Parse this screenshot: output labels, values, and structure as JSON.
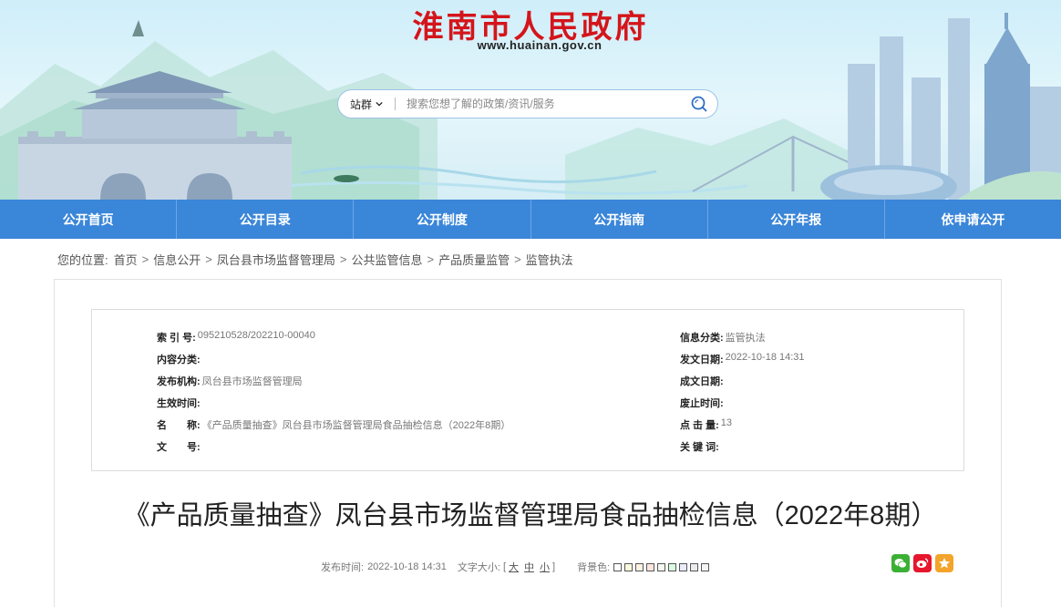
{
  "header": {
    "site_title": "淮南市人民政府",
    "site_url": "www.huainan.gov.cn"
  },
  "search": {
    "scope_label": "站群",
    "placeholder": "搜索您想了解的政策/资讯/服务"
  },
  "nav": {
    "items": [
      "公开首页",
      "公开目录",
      "公开制度",
      "公开指南",
      "公开年报",
      "依申请公开"
    ]
  },
  "breadcrumb": {
    "prefix": "您的位置:",
    "items": [
      "首页",
      "信息公开",
      "凤台县市场监督管理局",
      "公共监管信息",
      "产品质量监管",
      "监管执法"
    ],
    "separator": ">"
  },
  "meta": {
    "left": [
      {
        "label": "索 引 号:",
        "value": "095210528/202210-00040"
      },
      {
        "label": "内容分类:",
        "value": ""
      },
      {
        "label": "发布机构:",
        "value": "凤台县市场监督管理局"
      },
      {
        "label": "生效时间:",
        "value": ""
      },
      {
        "label": "名　　称:",
        "value": "《产品质量抽查》凤台县市场监督管理局食品抽检信息（2022年8期）"
      },
      {
        "label": "文　　号:",
        "value": ""
      }
    ],
    "right": [
      {
        "label": "信息分类:",
        "value": "监管执法"
      },
      {
        "label": "发文日期:",
        "value": "2022-10-18 14:31"
      },
      {
        "label": "成文日期:",
        "value": ""
      },
      {
        "label": "废止时间:",
        "value": ""
      },
      {
        "label": "点 击 量:",
        "value": "13"
      },
      {
        "label": "关 键 词:",
        "value": ""
      }
    ]
  },
  "article": {
    "title": "《产品质量抽查》凤台县市场监督管理局食品抽检信息（2022年8期）",
    "publish_label": "发布时间:",
    "publish_time": "2022-10-18 14:31",
    "font_size_label": "文字大小:",
    "font_size_open": "[",
    "font_sizes": [
      "大",
      "中",
      "小"
    ],
    "font_size_close": "]",
    "bg_color_label": "背景色:",
    "bg_colors": [
      "#ffffff",
      "#faf9de",
      "#fff2e2",
      "#fde6e0",
      "#f3f9f1",
      "#dafbe1",
      "#e9ebfe",
      "#eaeaef",
      "#f4f4f4"
    ]
  },
  "share": {
    "icons": [
      "wechat-icon",
      "weibo-icon",
      "favorite-icon"
    ],
    "colors": [
      "#3cb035",
      "#e6162d",
      "#f3a42a"
    ]
  },
  "colors": {
    "nav_bg": "#3a86d9",
    "title_red": "#d4151b"
  }
}
